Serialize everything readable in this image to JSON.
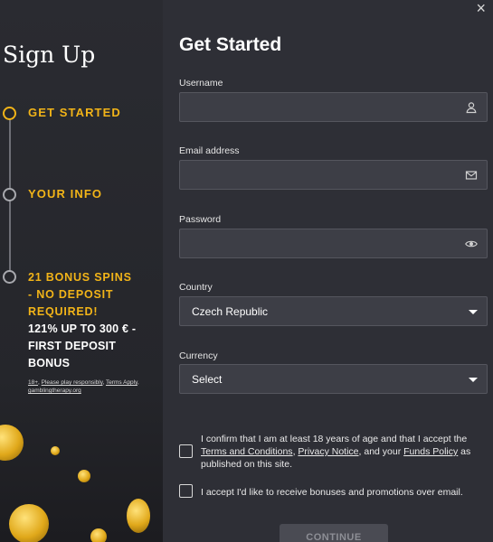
{
  "modal": {
    "close_glyph": "×"
  },
  "sidebar": {
    "title": "Sign Up",
    "steps": [
      {
        "label": "GET STARTED",
        "active": true
      },
      {
        "label": "YOUR INFO",
        "active": false
      }
    ],
    "bonus": {
      "yellow_lines": [
        "21 BONUS SPINS",
        "- NO DEPOSIT",
        "REQUIRED!"
      ],
      "white_lines": [
        "121% UP TO 300 € -",
        "FIRST DEPOSIT",
        "BONUS"
      ]
    },
    "links": {
      "age": "18+",
      "responsible": "Please play responsibly",
      "terms": "Terms Apply",
      "gambling_therapy": "gamblingtherapy.org"
    }
  },
  "form": {
    "title": "Get Started",
    "username": {
      "label": "Username",
      "value": "",
      "icon": "user-icon"
    },
    "email": {
      "label": "Email address",
      "value": "",
      "icon": "envelope-icon"
    },
    "password": {
      "label": "Password",
      "value": "",
      "icon": "eye-icon"
    },
    "country": {
      "label": "Country",
      "selected": "Czech Republic"
    },
    "currency": {
      "label": "Currency",
      "selected": "Select"
    },
    "consent1": {
      "text_before": "I confirm that I am at least 18 years of age and that I accept the",
      "terms": "Terms and Conditions",
      "sep1": ", ",
      "privacy": "Privacy Notice",
      "sep2": ", and your ",
      "funds": "Funds Policy",
      "text_after": " as published on this site.",
      "checked": false
    },
    "consent2": {
      "text": "I accept I'd like to receive bonuses and promotions over email.",
      "checked": false
    },
    "continue_label": "CONTINUE"
  },
  "colors": {
    "accent": "#f2b418",
    "panel": "#2e2f36",
    "field_bg": "#3d3e46"
  }
}
